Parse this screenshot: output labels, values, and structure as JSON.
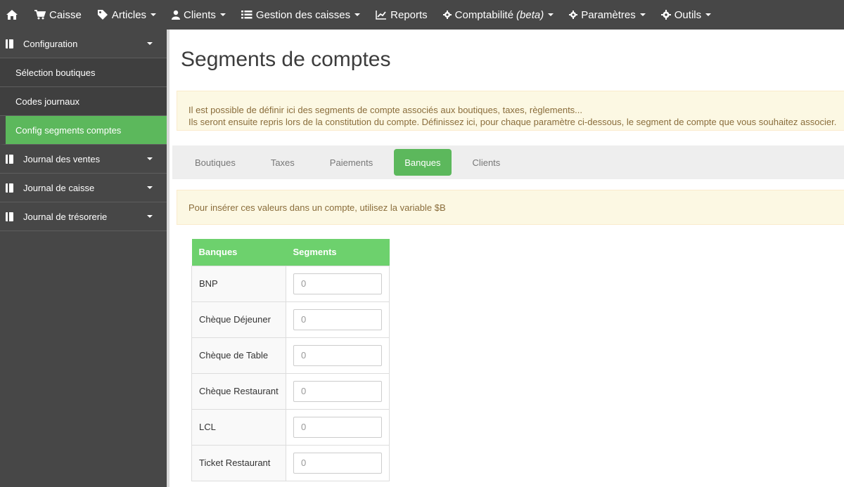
{
  "topnav": {
    "items": [
      {
        "label": "Caisse",
        "icon": "cart-icon"
      },
      {
        "label": "Articles",
        "icon": "tags-icon"
      },
      {
        "label": "Clients",
        "icon": "user-icon"
      },
      {
        "label": "Gestion des caisses",
        "icon": "list-icon"
      },
      {
        "label": "Reports",
        "icon": "line-chart-icon"
      },
      {
        "label": "Comptabilité",
        "beta": "(beta)",
        "icon": "cog-icon"
      },
      {
        "label": "Paramètres",
        "icon": "cog-icon"
      },
      {
        "label": "Outils",
        "icon": "cog-icon"
      }
    ]
  },
  "sidebar": {
    "sections": [
      {
        "label": "Configuration"
      },
      {
        "label": "Journal des ventes"
      },
      {
        "label": "Journal de caisse"
      },
      {
        "label": "Journal de trésorerie"
      }
    ],
    "subitems": [
      {
        "label": "Sélection boutiques"
      },
      {
        "label": "Codes journaux"
      },
      {
        "label": "Config segments comptes",
        "active": true
      }
    ]
  },
  "page": {
    "title": "Segments de comptes",
    "info_line1": "Il est possible de définir ici des segments de compte associés aux boutiques, taxes, règlements...",
    "info_line2": "Ils seront ensuite repris lors de la constitution du compte. Définissez ici, pour chaque paramètre ci-dessous, le segment de compte que vous souhaitez associer.",
    "variable_hint": "Pour insérer ces valeurs dans un compte, utilisez la variable $B"
  },
  "tabs": [
    {
      "label": "Boutiques"
    },
    {
      "label": "Taxes"
    },
    {
      "label": "Paiements"
    },
    {
      "label": "Banques",
      "active": true
    },
    {
      "label": "Clients"
    }
  ],
  "table": {
    "headers": [
      "Banques",
      "Segments"
    ],
    "rows": [
      {
        "label": "BNP",
        "placeholder": "0"
      },
      {
        "label": "Chèque Déjeuner",
        "placeholder": "0"
      },
      {
        "label": "Chèque de Table",
        "placeholder": "0"
      },
      {
        "label": "Chèque Restaurant",
        "placeholder": "0"
      },
      {
        "label": "LCL",
        "placeholder": "0"
      },
      {
        "label": "Ticket Restaurant",
        "placeholder": "0"
      }
    ]
  },
  "colors": {
    "navbar": "#474747",
    "accent_green": "#5cb85c",
    "table_header": "#6dd16d",
    "alert_bg": "#fcf8e3",
    "alert_text": "#8a6d3b"
  }
}
